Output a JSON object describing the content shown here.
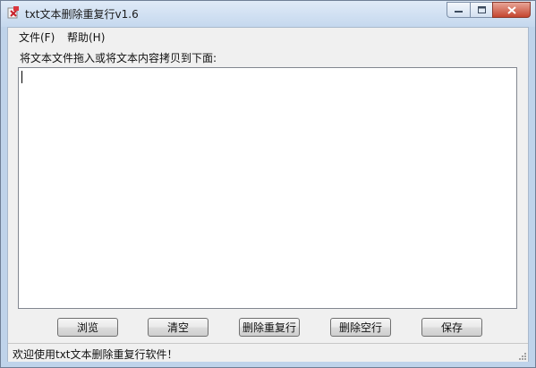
{
  "window": {
    "title": "txt文本删除重复行v1.6",
    "icon": "app-icon"
  },
  "menubar": {
    "file": "文件(F)",
    "help": "帮助(H)"
  },
  "main": {
    "prompt": "将文本文件拖入或将文本内容拷贝到下面:",
    "editor_value": ""
  },
  "buttons": {
    "browse": "浏览",
    "clear": "清空",
    "dedupe": "删除重复行",
    "remove_blank": "删除空行",
    "save": "保存"
  },
  "status": {
    "text": "欢迎使用txt文本删除重复行软件！"
  }
}
